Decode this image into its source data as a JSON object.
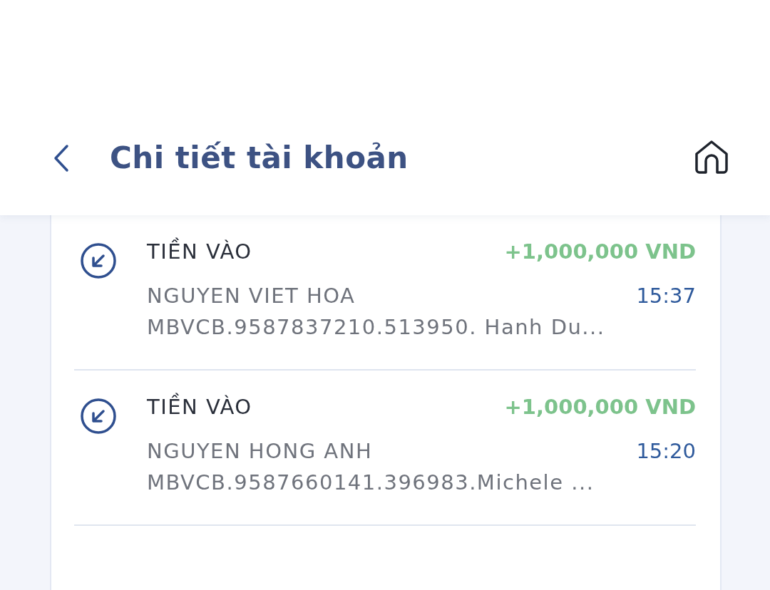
{
  "header": {
    "title": "Chi tiết tài khoản"
  },
  "transactions": [
    {
      "kind": "in",
      "type": "TIỀN VÀO",
      "amount": "+1,000,000 VND",
      "name": "NGUYEN VIET HOA",
      "time": "15:37",
      "description": "MBVCB.9587837210.513950. Hanh Du..."
    },
    {
      "kind": "in",
      "type": "TIỀN VÀO",
      "amount": "+1,000,000 VND",
      "name": "NGUYEN HONG ANH",
      "time": "15:20",
      "description": "MBVCB.9587660141.396983.Michele ..."
    }
  ]
}
